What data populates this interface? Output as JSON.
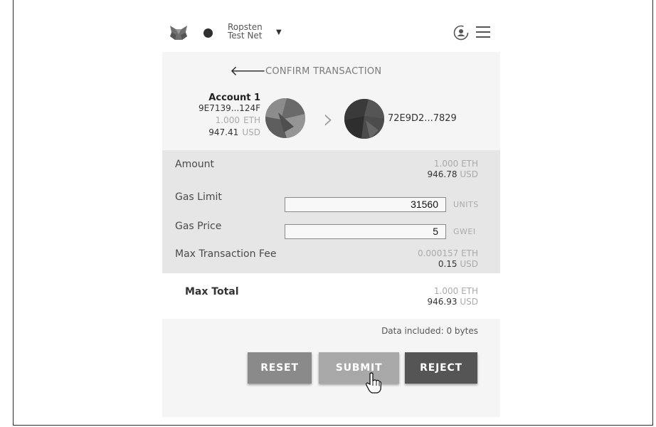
{
  "network": {
    "line1": "Ropsten",
    "line2": "Test Net"
  },
  "icons": {
    "logo": "metamask-fox-icon",
    "network_status": "network-dot-icon",
    "network_dropdown": "caret-down-icon",
    "account": "account-icon",
    "menu": "hamburger-menu-icon",
    "back": "back-arrow-icon",
    "arrow": "chevron-right-icon",
    "cursor": "hand-pointer-icon"
  },
  "header": {
    "title": "CONFIRM TRANSACTION"
  },
  "from": {
    "name": "Account 1",
    "address": "9E7139...124F",
    "balance_eth": "1.000",
    "eth_unit": "ETH",
    "balance_usd": "947.41",
    "usd_unit": "USD"
  },
  "to": {
    "address": "72E9D2...7829"
  },
  "details": {
    "amount": {
      "label": "Amount",
      "eth": "1.000",
      "eth_unit": "ETH",
      "usd": "946.78",
      "usd_unit": "USD"
    },
    "gas_limit": {
      "label": "Gas Limit",
      "value": "31560",
      "unit": "UNITS"
    },
    "gas_price": {
      "label": "Gas Price",
      "value": "5",
      "unit": "GWEI"
    },
    "max_fee": {
      "label": "Max Transaction Fee",
      "eth": "0.000157",
      "eth_unit": "ETH",
      "usd": "0.15",
      "usd_unit": "USD"
    }
  },
  "total": {
    "label": "Max Total",
    "eth": "1.000",
    "eth_unit": "ETH",
    "usd": "946.93",
    "usd_unit": "USD"
  },
  "data_included": "Data included: 0 bytes",
  "buttons": {
    "reset": "RESET",
    "submit": "SUBMIT",
    "reject": "REJECT"
  },
  "colors": {
    "reset_btn": "#8a8a8a",
    "submit_btn": "#a8a8a8",
    "reject_btn": "#555555",
    "details_bg": "#e6e6e6"
  }
}
